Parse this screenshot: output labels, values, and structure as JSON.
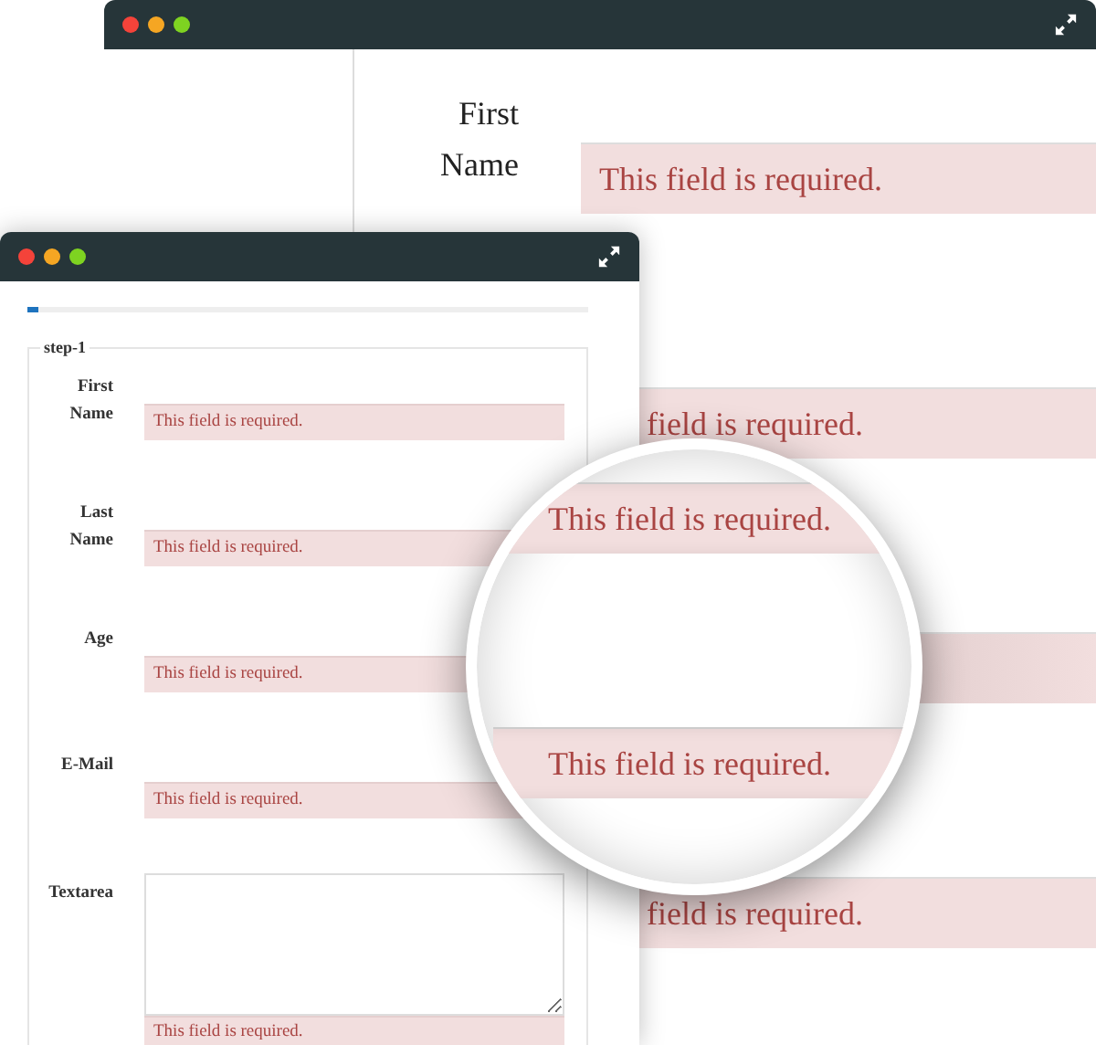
{
  "back_window": {
    "field_label": "First Name",
    "error_bars": [
      {
        "kind": "message",
        "text": "This field is required."
      },
      {
        "kind": "message",
        "text": "field is required."
      },
      {
        "kind": "covered"
      },
      {
        "kind": "message",
        "text": "field is required."
      }
    ]
  },
  "form_window": {
    "progress": {
      "level": 0.02
    },
    "legend": "step-1",
    "fields": [
      {
        "kind": "input",
        "label": "First Name",
        "error": "This field is required."
      },
      {
        "kind": "input",
        "label": "Last Name",
        "error": "This field is required."
      },
      {
        "kind": "input",
        "label": "Age",
        "error": "This field is required."
      },
      {
        "kind": "input",
        "label": "E-Mail",
        "error": "This field is required."
      },
      {
        "kind": "textarea",
        "label": "Textarea",
        "error": "This field is required."
      }
    ]
  },
  "magnifier": {
    "messages": [
      "This field is required.",
      "This field is required."
    ]
  }
}
